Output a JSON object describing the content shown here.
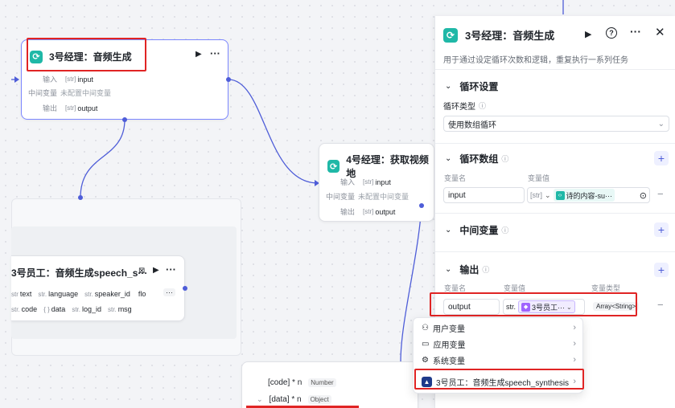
{
  "manager3_node": {
    "title": "3号经理：音频生成",
    "input_label": "输入",
    "input_type": "[str]",
    "input_value": "input",
    "mid_label": "中间变量",
    "mid_value": "未配置中间变量",
    "output_label": "输出",
    "output_type": "[str]",
    "output_value": "output"
  },
  "manager4_node": {
    "title": "4号经理：获取视频地",
    "input_label": "输入",
    "input_type": "[str]",
    "input_value": "input",
    "mid_label": "中间变量",
    "mid_value": "未配置中间变量",
    "output_label": "输出",
    "output_type": "[str]",
    "output_value": "output"
  },
  "employee_node": {
    "title": "3号员工：音频生成speech_s···",
    "params_row1": [
      {
        "type": "str",
        "name": "text"
      },
      {
        "type": "str.",
        "name": "language"
      },
      {
        "type": "str.",
        "name": "speaker_id"
      },
      {
        "type": "",
        "name": "flo"
      }
    ],
    "params_row2": [
      {
        "type": "str.",
        "name": "code"
      },
      {
        "type": "{ }",
        "name": "data"
      },
      {
        "type": "str.",
        "name": "log_id"
      },
      {
        "type": "str.",
        "name": "msg"
      }
    ],
    "more_label": "···"
  },
  "bottom_node": {
    "row1_key": "[code] * n",
    "row1_type": "Number",
    "row2_key": "[data] * n",
    "row2_type": "Object"
  },
  "panel": {
    "title": "3号经理：音频生成",
    "description": "用于通过设定循环次数和逻辑，重复执行一系列任务",
    "loop_settings": "循环设置",
    "loop_type_label": "循环类型",
    "loop_type_value": "使用数组循环",
    "loop_array": "循环数组",
    "var_name_header": "变量名",
    "var_value_header": "变量值",
    "loop_var_name": "input",
    "loop_var_type": "[str]",
    "loop_var_ref": "诗的内容-su···",
    "mid_vars": "中间变量",
    "output_section": "输出",
    "out_name_header": "变量名",
    "out_value_header": "变量值",
    "out_type_header": "变量类型",
    "out_var_name": "output",
    "out_var_type": "str.",
    "out_var_ref": "3号员工···",
    "out_var_datatype": "Array<String>",
    "minus": "−",
    "plus": "+"
  },
  "menu": {
    "items": [
      "用户变量",
      "应用变量",
      "系统变量"
    ],
    "selected": "3号员工：音频生成speech_synthesis"
  }
}
